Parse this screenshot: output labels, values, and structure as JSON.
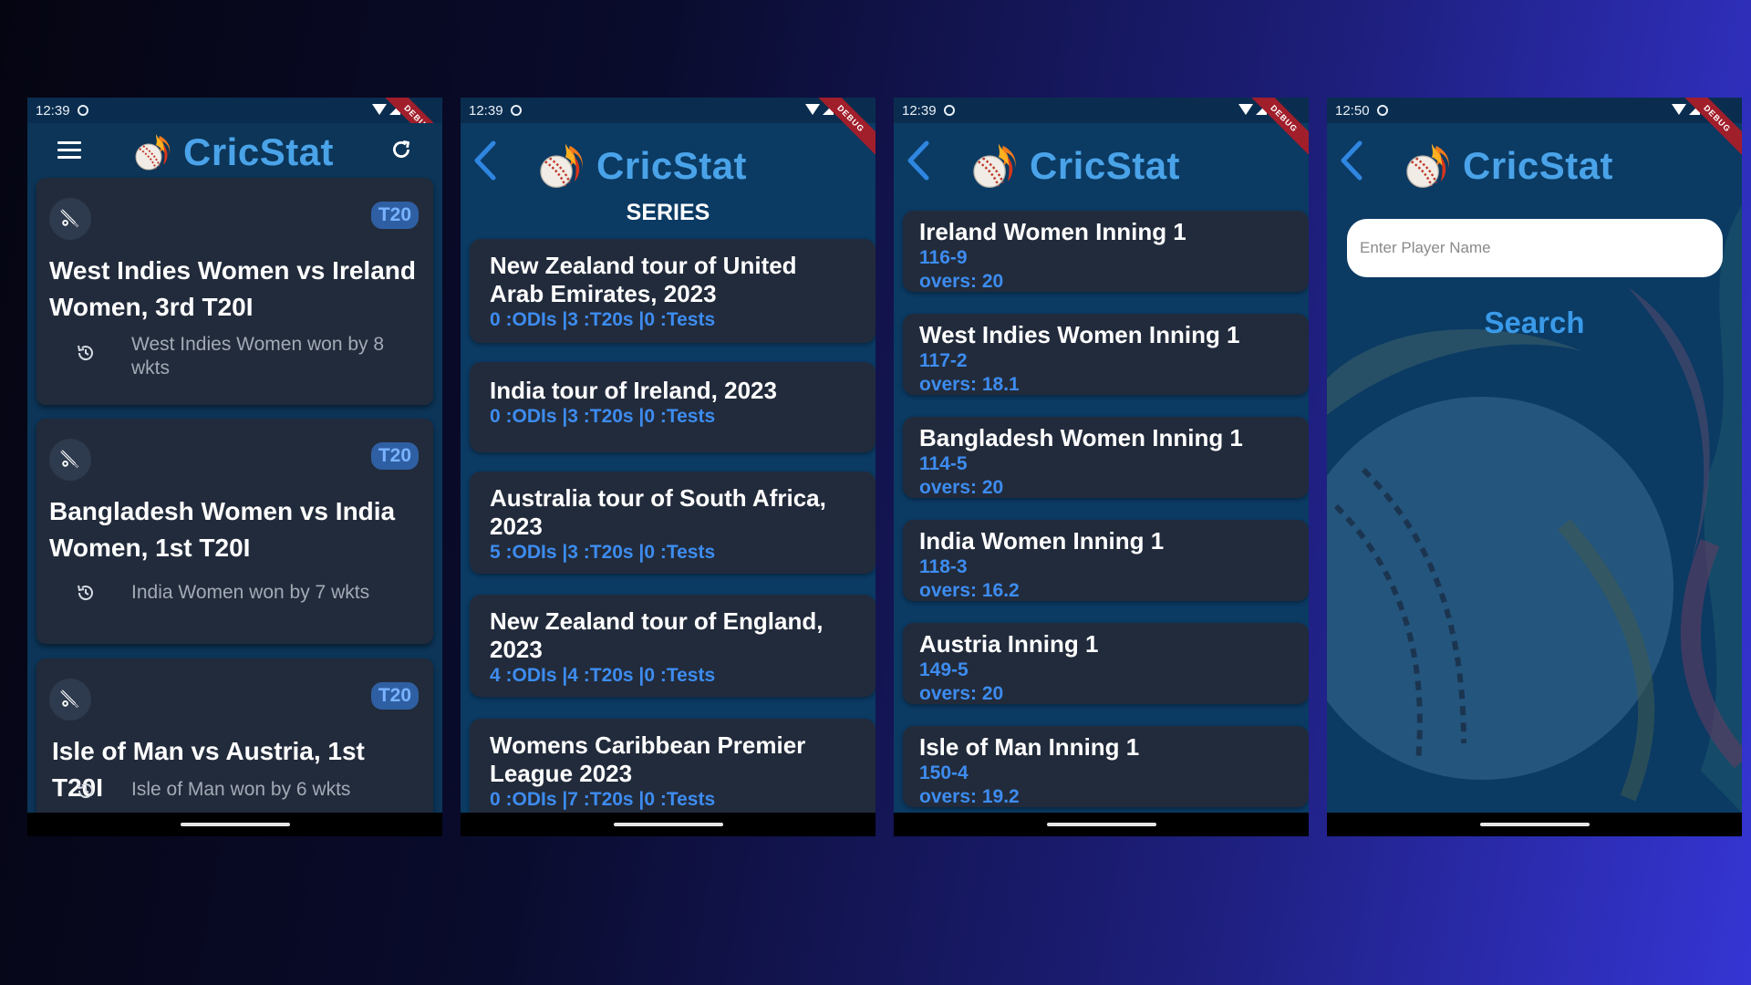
{
  "app": {
    "name": "CricStat",
    "debug_label": "DEBUG"
  },
  "phones": [
    {
      "time": "12:39",
      "matches": [
        {
          "format": "T20",
          "title": "West Indies Women vs Ireland Women, 3rd T20I",
          "result": "West Indies Women won by 8 wkts"
        },
        {
          "format": "T20",
          "title": "Bangladesh Women vs India Women, 1st T20I",
          "result": "India Women won by 7 wkts"
        },
        {
          "format": "T20",
          "title": "Isle of Man vs Austria, 1st T20I",
          "result": "Isle of Man won by 6 wkts"
        }
      ]
    },
    {
      "time": "12:39",
      "heading": "SERIES",
      "series": [
        {
          "name": "New Zealand tour of United Arab Emirates, 2023",
          "counts": "0 :ODIs |3 :T20s |0 :Tests"
        },
        {
          "name": "India tour of Ireland, 2023",
          "counts": "0 :ODIs |3 :T20s |0 :Tests"
        },
        {
          "name": "Australia tour of South Africa, 2023",
          "counts": "5 :ODIs |3 :T20s |0 :Tests"
        },
        {
          "name": "New Zealand tour of England, 2023",
          "counts": "4 :ODIs |4 :T20s |0 :Tests"
        },
        {
          "name": "Womens Caribbean Premier League 2023",
          "counts": "0 :ODIs |7 :T20s |0 :Tests"
        }
      ]
    },
    {
      "time": "12:39",
      "innings": [
        {
          "team": "Ireland Women Inning 1",
          "score": "116-9",
          "overs": "overs: 20"
        },
        {
          "team": "West Indies Women Inning 1",
          "score": "117-2",
          "overs": "overs: 18.1"
        },
        {
          "team": "Bangladesh Women Inning 1",
          "score": "114-5",
          "overs": "overs: 20"
        },
        {
          "team": "India Women Inning 1",
          "score": "118-3",
          "overs": "overs: 16.2"
        },
        {
          "team": "Austria Inning 1",
          "score": "149-5",
          "overs": "overs: 20"
        },
        {
          "team": "Isle of Man Inning 1",
          "score": "150-4",
          "overs": "overs: 19.2"
        }
      ]
    },
    {
      "time": "12:50",
      "search": {
        "placeholder": "Enter Player Name",
        "button": "Search"
      }
    }
  ],
  "colors": {
    "accent": "#4aa3e8",
    "link": "#3d8cf0",
    "card": "#222b3b",
    "screen": "#0b3a63",
    "badge": "#2f5fa3"
  },
  "icons": [
    "menu-icon",
    "refresh-icon",
    "back-arrow-icon",
    "cricket-ball-logo",
    "cricket-bat-icon",
    "history-icon",
    "wifi-icon",
    "signal-icon",
    "battery-icon"
  ]
}
